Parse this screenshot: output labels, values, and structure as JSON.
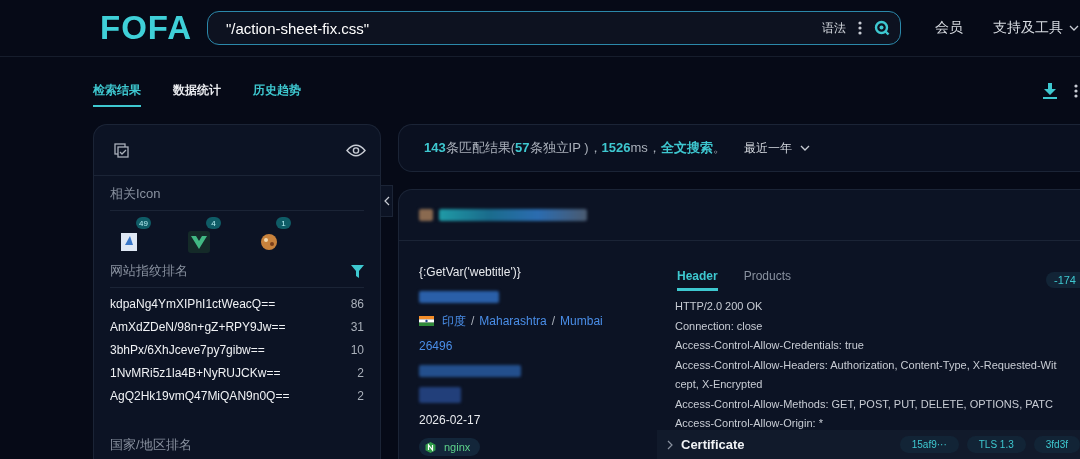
{
  "logo": "FOFA",
  "search": {
    "value": "\"/action-sheet-fix.css\"",
    "syntax_label": "语法"
  },
  "nav": [
    {
      "label": "会员",
      "dropdown": false
    },
    {
      "label": "支持及工具",
      "dropdown": true
    }
  ],
  "tabs": [
    {
      "label": "检索结果",
      "selected": true,
      "color": "#3ec8d0"
    },
    {
      "label": "数据统计",
      "selected": false,
      "color": "#e8eaee"
    },
    {
      "label": "历史趋势",
      "selected": false,
      "color": "#3ec8d0"
    }
  ],
  "sidebar": {
    "icons_title": "相关Icon",
    "icons": [
      {
        "kind": "doc",
        "count": "49"
      },
      {
        "kind": "v",
        "count": "4"
      },
      {
        "kind": "cookie",
        "count": "1"
      }
    ],
    "fingerprint_title": "网站指纹排名",
    "fingerprints": [
      {
        "name": "kdpaNg4YmXIPhI1ctWeacQ==",
        "count": "86"
      },
      {
        "name": "AmXdZDeN/98n+gZ+RPY9Jw==",
        "count": "31"
      },
      {
        "name": "3bhPx/6XhJceve7py7gibw==",
        "count": "10"
      },
      {
        "name": "1NvMRi5z1la4B+NyRUJCKw==",
        "count": "2"
      },
      {
        "name": "AgQ2Hk19vmQ47MiQAN9n0Q==",
        "count": "2"
      }
    ],
    "country_title": "国家/地区排名"
  },
  "summary": {
    "segments": [
      {
        "text": "143",
        "kind": "highlight"
      },
      {
        "text": "条匹配结果(",
        "kind": "plain"
      },
      {
        "text": "57",
        "kind": "highlight"
      },
      {
        "text": "条独立IP )，",
        "kind": "plain"
      },
      {
        "text": "1526",
        "kind": "highlight"
      },
      {
        "text": "ms，",
        "kind": "plain"
      },
      {
        "text": "全文搜索",
        "kind": "highlight"
      },
      {
        "text": "。",
        "kind": "plain"
      }
    ],
    "range": "最近一年"
  },
  "result": {
    "title": "{:GetVar('webtitle')}",
    "location": [
      {
        "kind": "link",
        "text": "印度"
      },
      {
        "kind": "separator",
        "text": "/"
      },
      {
        "kind": "link",
        "text": "Maharashtra"
      },
      {
        "kind": "separator",
        "text": "/"
      },
      {
        "kind": "link",
        "text": "Mumbai"
      }
    ],
    "asn": "26496",
    "date": "2026-02-17",
    "server": "nginx",
    "detail_tabs": [
      {
        "label": "Header",
        "selected": true
      },
      {
        "label": "Products",
        "selected": false
      }
    ],
    "badge": "-174",
    "header_lines": [
      "HTTP/2.0 200 OK",
      "Connection: close",
      "Access-Control-Allow-Credentials: true",
      "Access-Control-Allow-Headers: Authorization, Content-Type, X-Requested-Wit",
      "cept, X-Encrypted",
      "Access-Control-Allow-Methods: GET, POST, PUT, DELETE, OPTIONS, PATC",
      "Access-Control-Allow-Origin: *"
    ],
    "certificate": {
      "label": "Certificate",
      "tags": [
        "15af9···",
        "TLS 1.3",
        "3fd3f"
      ]
    }
  }
}
